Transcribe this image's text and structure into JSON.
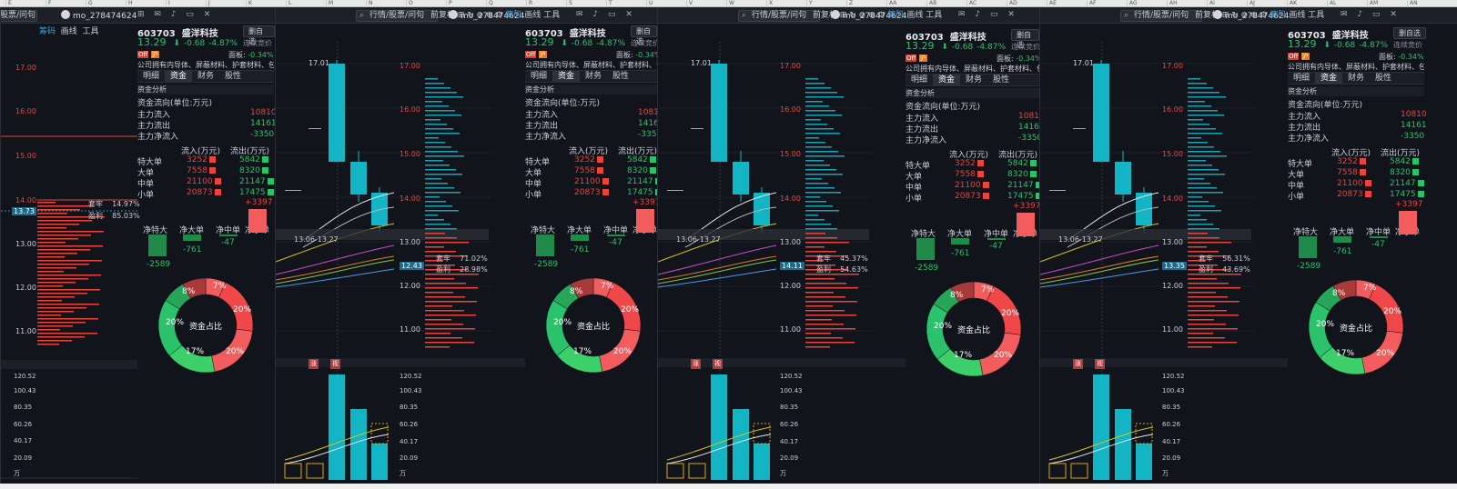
{
  "excel": {
    "columns": [
      "E",
      "F",
      "G",
      "H",
      "I",
      "J",
      "K",
      "L",
      "M",
      "N",
      "O",
      "P",
      "Q",
      "R",
      "S",
      "T",
      "U",
      "V",
      "W",
      "X",
      "Y",
      "Z",
      "AA",
      "AB",
      "AC",
      "AD",
      "AE",
      "AF",
      "AG",
      "AH",
      "AI",
      "AJ",
      "AK",
      "AL",
      "AM",
      "AN"
    ]
  },
  "window": {
    "search_placeholder": "行情/股票/问句",
    "username": "mo_278474624",
    "search_partial": "股票/问句"
  },
  "toolbar": {
    "tab1": "筹码",
    "tab2": "画线",
    "tab3": "工具",
    "fuquan": "前复权"
  },
  "stock": {
    "code": "603703",
    "name": "盛洋科技",
    "price": "13.29",
    "arrow": "⬇",
    "change": "-0.68",
    "pct": "-4.87%",
    "btn_del": "删自选",
    "btn_lianbao": "连续竞价",
    "panel_label": "面板:",
    "panel_val": "-0.34%",
    "desc": "公司拥有内导体、屏蔽材料、护套材料、包装...",
    "tags": [
      "Off",
      "沪"
    ]
  },
  "tabs": [
    "明细",
    "资金",
    "财务",
    "股性"
  ],
  "fund": {
    "section": "资金分析",
    "title": "资金流向(单位:万元)",
    "rows": [
      {
        "label": "主力流入",
        "value": "10810"
      },
      {
        "label": "主力流出",
        "value": "14161"
      },
      {
        "label": "主力净流入",
        "value": "-3350"
      }
    ],
    "hdr_in": "流入(万元)",
    "hdr_out": "流出(万元)",
    "orders": [
      {
        "label": "特大单",
        "in": "3252",
        "out": "5842"
      },
      {
        "label": "大单",
        "in": "7558",
        "out": "8320"
      },
      {
        "label": "中单",
        "in": "21100",
        "out": "21147"
      },
      {
        "label": "小单",
        "in": "20873",
        "out": "17475"
      }
    ],
    "net": [
      {
        "label": "净特大",
        "value": "-2589"
      },
      {
        "label": "净大单",
        "value": "-761"
      },
      {
        "label": "净中单",
        "value": "-47"
      },
      {
        "label": "净小单",
        "value": "+3397"
      }
    ],
    "donut": {
      "center": "资金占比",
      "slices": [
        "7%",
        "20%",
        "20%",
        "17%",
        "20%",
        "8%"
      ]
    }
  },
  "chart_ticks": [
    "17.00",
    "16.00",
    "15.00",
    "14.00",
    "13.00",
    "12.00",
    "11.00"
  ],
  "vol_ticks": [
    "120.52",
    "100.43",
    "80.35",
    "60.26",
    "40.17",
    "20.09",
    "万"
  ],
  "chip": {
    "p1": {
      "level": "13.73",
      "a": "套牢",
      "av": "14.97%",
      "b": "盈利",
      "bv": "85.03%"
    },
    "p2": {
      "level": "12.43",
      "a": "套牢",
      "av": "71.02%",
      "b": "盈利",
      "bv": "28.98%"
    },
    "p3": {
      "level": "14.11",
      "a": "套牢",
      "av": "45.37%",
      "b": "盈利",
      "bv": "54.63%"
    },
    "p4": {
      "level": "13.35",
      "a": "套牢",
      "av": "56.31%",
      "b": "盈利",
      "bv": "43.69%"
    }
  },
  "kline": {
    "high_label": "17.01",
    "range_label": "13.06-13.27",
    "badges": [
      "涨",
      "视"
    ]
  },
  "colors": {
    "up": "#e8453c",
    "down": "#2ac26a",
    "candle": "#13b4c4",
    "bg": "#12141c"
  }
}
